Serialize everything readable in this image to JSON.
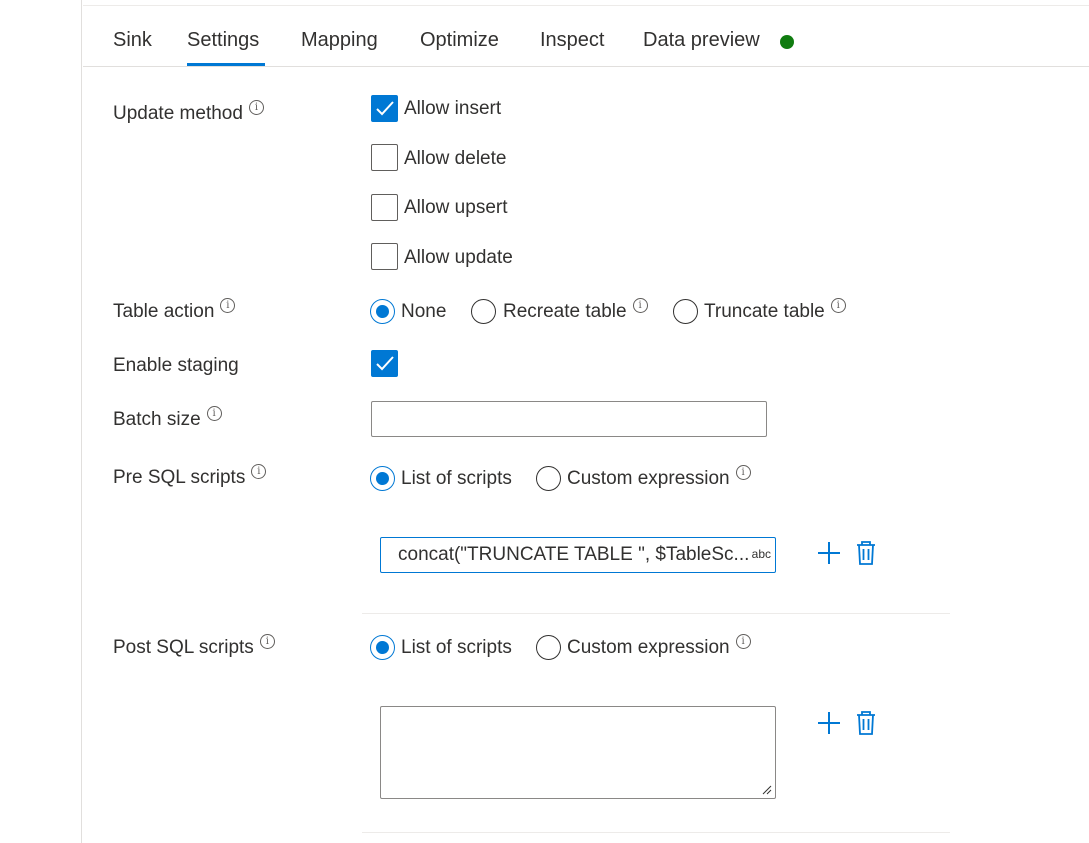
{
  "tabs": [
    {
      "label": "Sink"
    },
    {
      "label": "Settings"
    },
    {
      "label": "Mapping"
    },
    {
      "label": "Optimize"
    },
    {
      "label": "Inspect"
    },
    {
      "label": "Data preview"
    }
  ],
  "active_tab": "Settings",
  "status_dot_color": "#107c10",
  "accent_color": "#0078d4",
  "update_method": {
    "label": "Update method",
    "options": [
      {
        "label": "Allow insert",
        "checked": true
      },
      {
        "label": "Allow delete",
        "checked": false
      },
      {
        "label": "Allow upsert",
        "checked": false
      },
      {
        "label": "Allow update",
        "checked": false
      }
    ]
  },
  "table_action": {
    "label": "Table action",
    "options": [
      {
        "label": "None",
        "selected": true
      },
      {
        "label": "Recreate table",
        "selected": false
      },
      {
        "label": "Truncate table",
        "selected": false
      }
    ]
  },
  "enable_staging": {
    "label": "Enable staging",
    "checked": true
  },
  "batch_size": {
    "label": "Batch size",
    "value": ""
  },
  "pre_sql": {
    "label": "Pre SQL scripts",
    "options": [
      {
        "label": "List of scripts",
        "selected": true
      },
      {
        "label": "Custom expression",
        "selected": false
      }
    ],
    "script_value": "concat(\"TRUNCATE TABLE \", $TableSc...",
    "type_badge": "abc"
  },
  "post_sql": {
    "label": "Post SQL scripts",
    "options": [
      {
        "label": "List of scripts",
        "selected": true
      },
      {
        "label": "Custom expression",
        "selected": false
      }
    ],
    "script_value": ""
  },
  "icons": {
    "info": "info-icon",
    "add": "plus-icon",
    "delete": "trash-icon",
    "check": "checkmark-icon"
  }
}
